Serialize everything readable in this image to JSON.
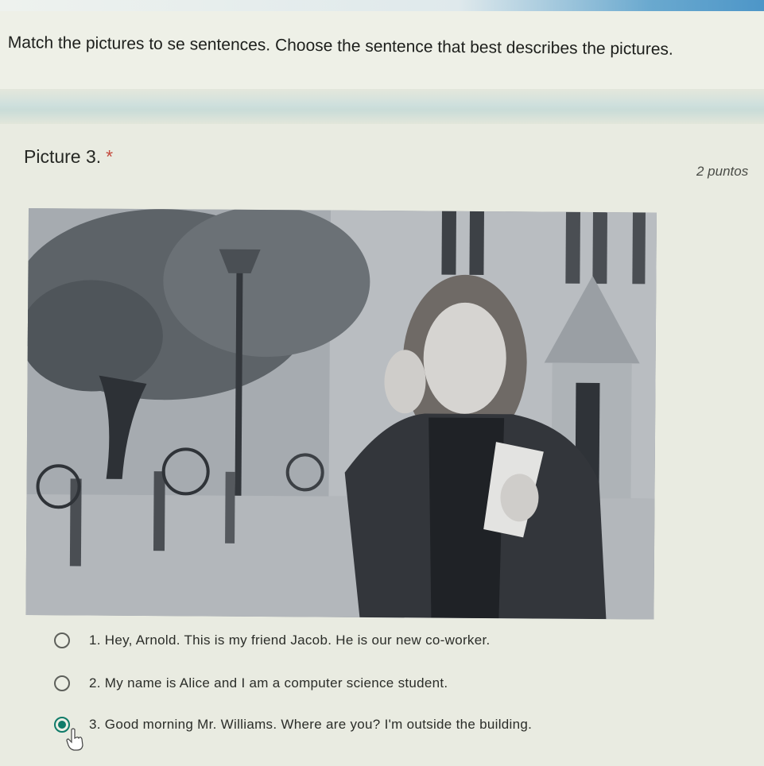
{
  "section": {
    "description": "Match the pictures to se sentences. Choose the sentence that best describes the pictures."
  },
  "question": {
    "title": "Picture 3.",
    "required_marker": "*",
    "points": "2 puntos",
    "options": [
      {
        "label": "1. Hey, Arnold. This is my friend Jacob. He is our new co-worker.",
        "selected": false
      },
      {
        "label": "2. My name is Alice and I am a computer science student.",
        "selected": false
      },
      {
        "label": "3. Good morning Mr. Williams. Where are you? I'm outside the building.",
        "selected": true
      }
    ]
  },
  "colors": {
    "accent": "#0f7b69",
    "required": "#c44b3e",
    "top_bar": "#4d96c8"
  },
  "cursor": {
    "icon": "hand-pointer-icon"
  }
}
